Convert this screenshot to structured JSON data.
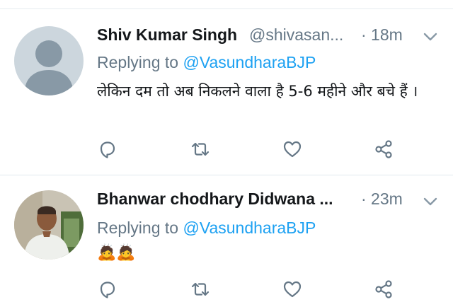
{
  "tweets": [
    {
      "name": "Shiv Kumar Singh",
      "handle": "@shivasan...",
      "time": "· 18m",
      "replying_prefix": "Replying to ",
      "replying_to": "@VasundharaBJP",
      "text": "लेकिन दम तो अब निकलने वाला है 5-6 महीने और बचे हैं ।",
      "avatar": "default-avatar"
    },
    {
      "name": "Bhanwar chodhary Didwana ...",
      "handle": "",
      "time": "· 23m",
      "replying_prefix": "Replying to ",
      "replying_to": "@VasundharaBJP",
      "text": "🙇🙇",
      "avatar": "photo-avatar"
    }
  ],
  "actions": [
    "reply-icon",
    "retweet-icon",
    "like-icon",
    "share-icon"
  ],
  "colors": {
    "link": "#1da1f2",
    "muted": "#657786",
    "icon": "#657786",
    "avatar_bg": "#ccd6dd"
  }
}
